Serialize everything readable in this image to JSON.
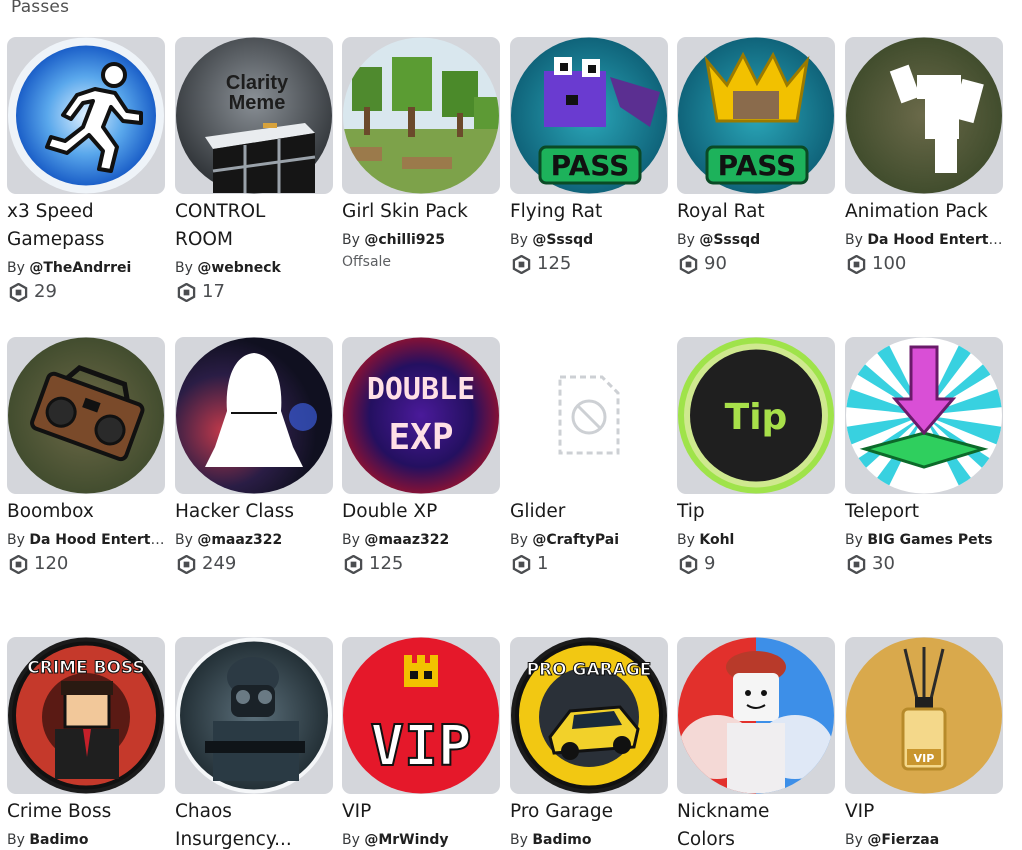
{
  "section": {
    "title": "Passes"
  },
  "by_label": "By",
  "offsale_label": "Offsale",
  "items": [
    {
      "title": "x3 Speed\nGamepass",
      "creator": "@TheAndrrei",
      "price": "29",
      "icon": "running-man-icon"
    },
    {
      "title": "CONTROL\nROOM",
      "creator": "@webneck",
      "price": "17",
      "icon": "clarity-meme-icon",
      "thumb_text": "Clarity\nMeme"
    },
    {
      "title": "Girl Skin Pack",
      "creator": "@chilli925",
      "status": "Offsale",
      "icon": "minecraft-forest-icon"
    },
    {
      "title": "Flying Rat",
      "creator": "@Sssqd",
      "price": "125",
      "icon": "purple-rat-pass-icon",
      "thumb_text": "PASS"
    },
    {
      "title": "Royal Rat",
      "creator": "@Sssqd",
      "price": "90",
      "icon": "crowned-rat-pass-icon",
      "thumb_text": "PASS"
    },
    {
      "title": "Animation Pack",
      "creator": "Da Hood Entertainment",
      "price": "100",
      "icon": "dancing-figure-icon"
    },
    {
      "title": "Boombox",
      "creator": "Da Hood Entertainment",
      "price": "120",
      "icon": "boombox-icon"
    },
    {
      "title": "Hacker Class",
      "creator": "@maaz322",
      "price": "249",
      "icon": "hooded-hacker-icon"
    },
    {
      "title": "Double XP",
      "creator": "@maaz322",
      "price": "125",
      "icon": "double-exp-icon",
      "thumb_text": "DOUBLE\nEXP"
    },
    {
      "title": "Glider",
      "creator": "@CraftyPai",
      "price": "1",
      "icon": "unavailable-image-icon"
    },
    {
      "title": "Tip",
      "creator": "Kohl",
      "price": "9",
      "icon": "tip-coin-icon",
      "thumb_text": "Tip"
    },
    {
      "title": "Teleport",
      "creator": "BIG Games Pets",
      "price": "30",
      "icon": "teleport-arrow-icon"
    },
    {
      "title": "Crime Boss",
      "creator": "Badimo",
      "icon": "crime-boss-badge-icon",
      "thumb_text": "CRIME BOSS"
    },
    {
      "title": "Chaos\nInsurgency...",
      "creator": null,
      "icon": "soldier-gasmask-icon"
    },
    {
      "title": "VIP",
      "creator": "@MrWindy",
      "icon": "pixel-vip-crown-icon",
      "thumb_text": "VIP"
    },
    {
      "title": "Pro Garage",
      "creator": "Badimo",
      "icon": "pro-garage-car-icon",
      "thumb_text": "PRO GARAGE"
    },
    {
      "title": "Nickname\nColors",
      "creator": null,
      "icon": "muscle-character-icon"
    },
    {
      "title": "VIP",
      "creator": "@Fierzaa",
      "icon": "vip-perfume-bottle-icon",
      "thumb_text": "VIP"
    }
  ],
  "colors": {
    "thumb_bg": "#d4d6db",
    "text": "#1a1a1a",
    "muted": "#4b4d50"
  }
}
